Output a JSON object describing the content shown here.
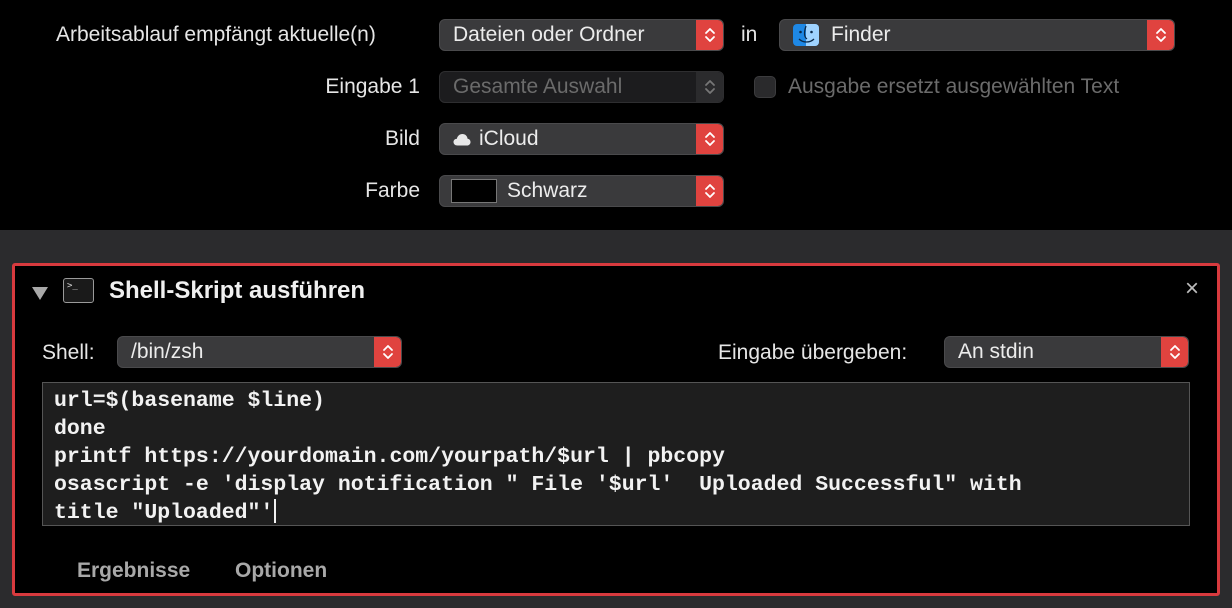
{
  "workflow": {
    "receives_label": "Arbeitsablauf empfängt aktuelle(n)",
    "receives_value": "Dateien oder Ordner",
    "in_label": "in",
    "app_value": "Finder",
    "input_label": "Eingabe 1",
    "input_value": "Gesamte Auswahl",
    "replace_label": "Ausgabe ersetzt ausgewählten Text",
    "replace_checked": false,
    "image_label": "Bild",
    "image_value": "iCloud",
    "color_label": "Farbe",
    "color_value": "Schwarz",
    "color_swatch": "#000000"
  },
  "action": {
    "title": "Shell-Skript ausführen",
    "close_glyph": "×",
    "shell_label": "Shell:",
    "shell_value": "/bin/zsh",
    "pass_input_label": "Eingabe übergeben:",
    "pass_input_value": "An stdin",
    "script_lines": [
      "url=$(basename $line)",
      "done",
      "printf https://yourdomain.com/yourpath/$url | pbcopy",
      "osascript -e 'display notification \" File '$url'  Uploaded Successful\" with",
      "title \"Uploaded\"'"
    ],
    "tabs": [
      "Ergebnisse",
      "Optionen"
    ],
    "highlight_color": "#d83a3e"
  },
  "colors": {
    "stepper_accent": "#e0433f",
    "background": "#000000",
    "panel_band": "#2b2b2d"
  },
  "icons": [
    "finder-icon",
    "icloud-icon",
    "terminal-icon",
    "disclosure-triangle-icon",
    "close-icon",
    "stepper-icon"
  ]
}
